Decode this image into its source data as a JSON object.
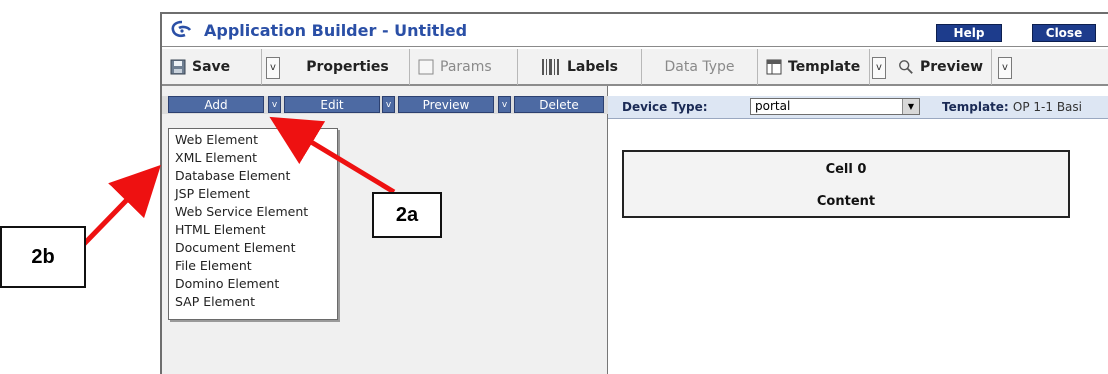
{
  "window": {
    "title": "Application Builder - Untitled",
    "help_label": "Help",
    "close_label": "Close"
  },
  "toolbar": {
    "save_label": "Save",
    "properties_label": "Properties",
    "params_label": "Params",
    "labels_label": "Labels",
    "datatype_label": "Data Type",
    "template_label": "Template",
    "preview_label": "Preview",
    "arrow_glyph": "v"
  },
  "element_tabs": {
    "add_label": "Add",
    "edit_label": "Edit",
    "preview_label": "Preview",
    "delete_label": "Delete",
    "arrow_glyph": "v"
  },
  "add_menu": {
    "items": [
      "Web Element",
      "XML Element",
      "Database Element",
      "JSP Element",
      "Web Service Element",
      "HTML Element",
      "Document Element",
      "File Element",
      "Domino Element",
      "SAP Element"
    ]
  },
  "device": {
    "label": "Device Type:",
    "value": "portal",
    "template_label": "Template:",
    "template_value": "OP 1-1 Basi"
  },
  "cell": {
    "title": "Cell 0",
    "content": "Content"
  },
  "annotations": {
    "callout_a": "2a",
    "callout_b": "2b",
    "arrow_color": "#ee1111"
  },
  "colors": {
    "title_blue": "#2a4fa6",
    "button_navy": "#1d3c8c",
    "tab_blue": "#4d6aa3"
  }
}
